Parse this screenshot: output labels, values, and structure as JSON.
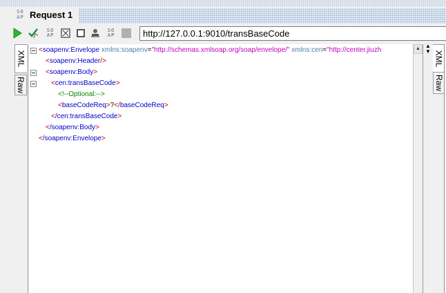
{
  "window": {
    "title": "Request 1",
    "title_icon_text": "SO\nAP"
  },
  "toolbar": {
    "buttons": [
      {
        "name": "submit-request-icon"
      },
      {
        "name": "validate-icon"
      },
      {
        "name": "soap-format-icon"
      },
      {
        "name": "maximize-editor-icon"
      },
      {
        "name": "stop-icon"
      },
      {
        "name": "add-user-icon"
      },
      {
        "name": "soap-icon"
      },
      {
        "name": "disabled-square-icon"
      }
    ],
    "endpoint_url": "http://127.0.0.1:9010/transBaseCode"
  },
  "left_tabs": {
    "xml_label": "XML",
    "raw_label": "Raw"
  },
  "right_tabs": {
    "xml_label": "XML",
    "raw_label": "Raw"
  },
  "xml": {
    "envelope_open": "soapenv:Envelope",
    "attr1_name": "xmlns:soapenv",
    "attr1_value": "\"http://schemas.xmlsoap.org/soap/envelope/\"",
    "attr2_name": "xmlns:cen",
    "attr2_value": "\"http://center.jiuzh",
    "header": "soapenv:Header",
    "body_open": "soapenv:Body",
    "trans_open": "cen:transBaseCode",
    "comment": "<!--Optional:-->",
    "basecode_tag": "baseCodeReq",
    "basecode_value": "?",
    "trans_close": "/cen:transBaseCode",
    "body_close": "/soapenv:Body",
    "envelope_close": "/soapenv:Envelope"
  },
  "colors": {
    "tag": "#0000c8",
    "bracket": "#c00000",
    "attribute": "#4a7fa8",
    "value": "#c000c0",
    "comment": "#008000"
  }
}
